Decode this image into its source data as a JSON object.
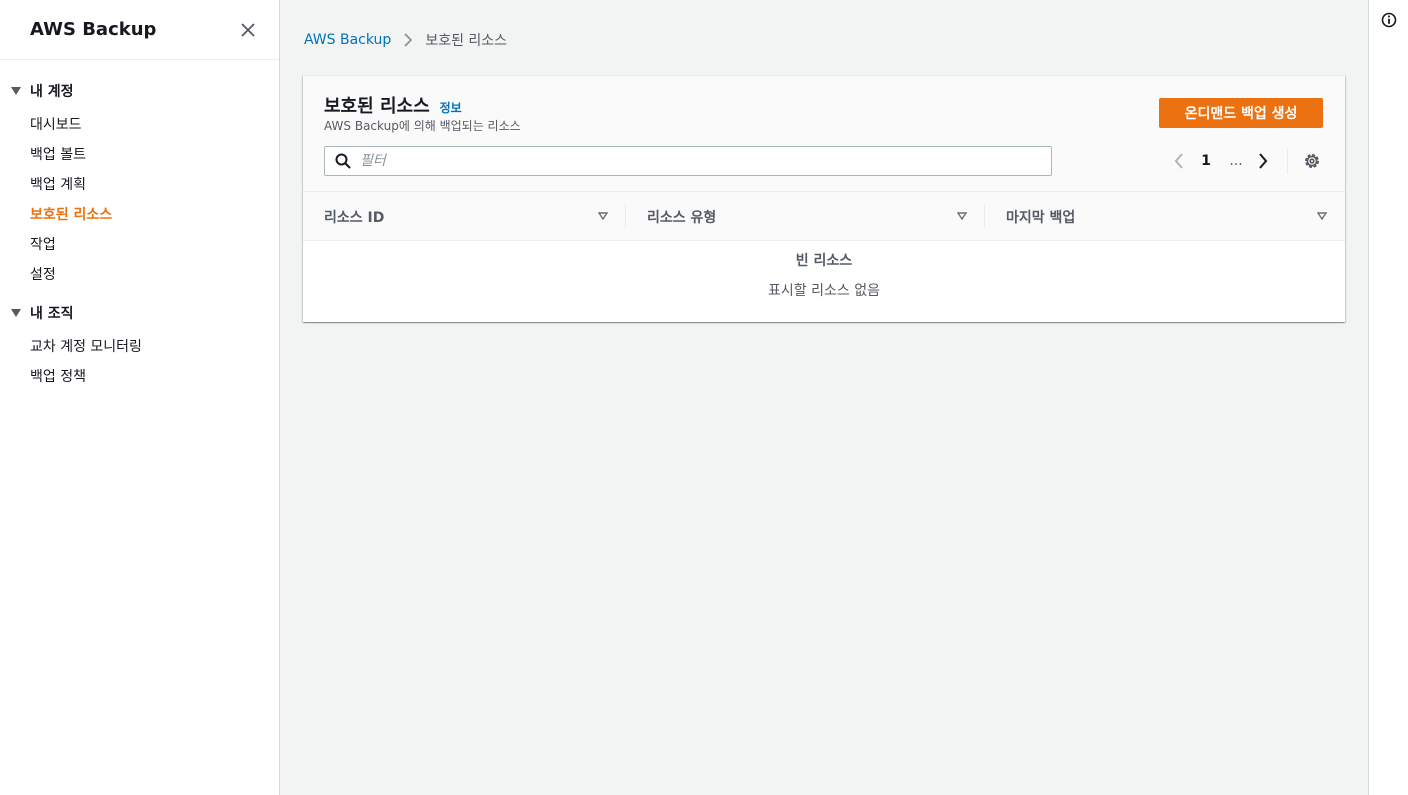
{
  "sidebar": {
    "title": "AWS Backup",
    "sections": [
      {
        "label": "내 계정",
        "items": [
          {
            "label": "대시보드"
          },
          {
            "label": "백업 볼트"
          },
          {
            "label": "백업 계획"
          },
          {
            "label": "보호된 리소스"
          },
          {
            "label": "작업"
          },
          {
            "label": "설정"
          }
        ]
      },
      {
        "label": "내 조직",
        "items": [
          {
            "label": "교차 계정 모니터링"
          },
          {
            "label": "백업 정책"
          }
        ]
      }
    ],
    "active_item": "보호된 리소스"
  },
  "breadcrumb": {
    "root": "AWS Backup",
    "current": "보호된 리소스"
  },
  "panel": {
    "title": "보호된 리소스",
    "info_link": "정보",
    "description": "AWS Backup에 의해 백업되는 리소스",
    "primary_button": "온디맨드 백업 생성",
    "search_placeholder": "필터",
    "pagination": {
      "current_page": "1",
      "ellipsis": "..."
    },
    "table": {
      "columns": [
        "리소스 ID",
        "리소스 유형",
        "마지막 백업"
      ],
      "empty_title": "빈 리소스",
      "empty_message": "표시할 리소스 없음"
    }
  },
  "colors": {
    "accent": "#ec7211",
    "link": "#0073bb",
    "background": "#f2f3f3"
  }
}
